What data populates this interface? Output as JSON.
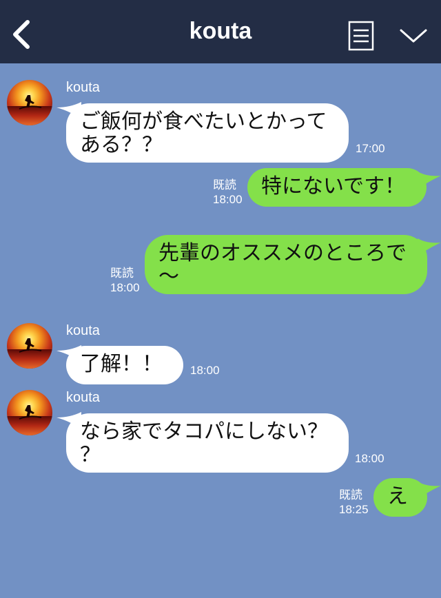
{
  "header": {
    "title": "kouta"
  },
  "messages": [
    {
      "sender": "kouta",
      "text_lines": [
        "ご飯何が食べたいとかって",
        "ある？？"
      ],
      "time": "17:00"
    },
    {
      "read": "既読",
      "time": "18:00",
      "text": "特にないです！"
    },
    {
      "read": "既読",
      "time": "18:00",
      "text_lines": [
        "先輩のオススメのところで",
        "〜"
      ]
    },
    {
      "sender": "kouta",
      "text": "了解！！",
      "time": "18:00"
    },
    {
      "sender": "kouta",
      "text_lines": [
        "なら家でタコパにしない？",
        "？"
      ],
      "time": "18:00"
    },
    {
      "read": "既読",
      "time": "18:25",
      "text": "え"
    }
  ],
  "colors": {
    "header": "#232d45",
    "background": "#7291c4",
    "outgoing": "#84e04a",
    "incoming": "#ffffff"
  }
}
